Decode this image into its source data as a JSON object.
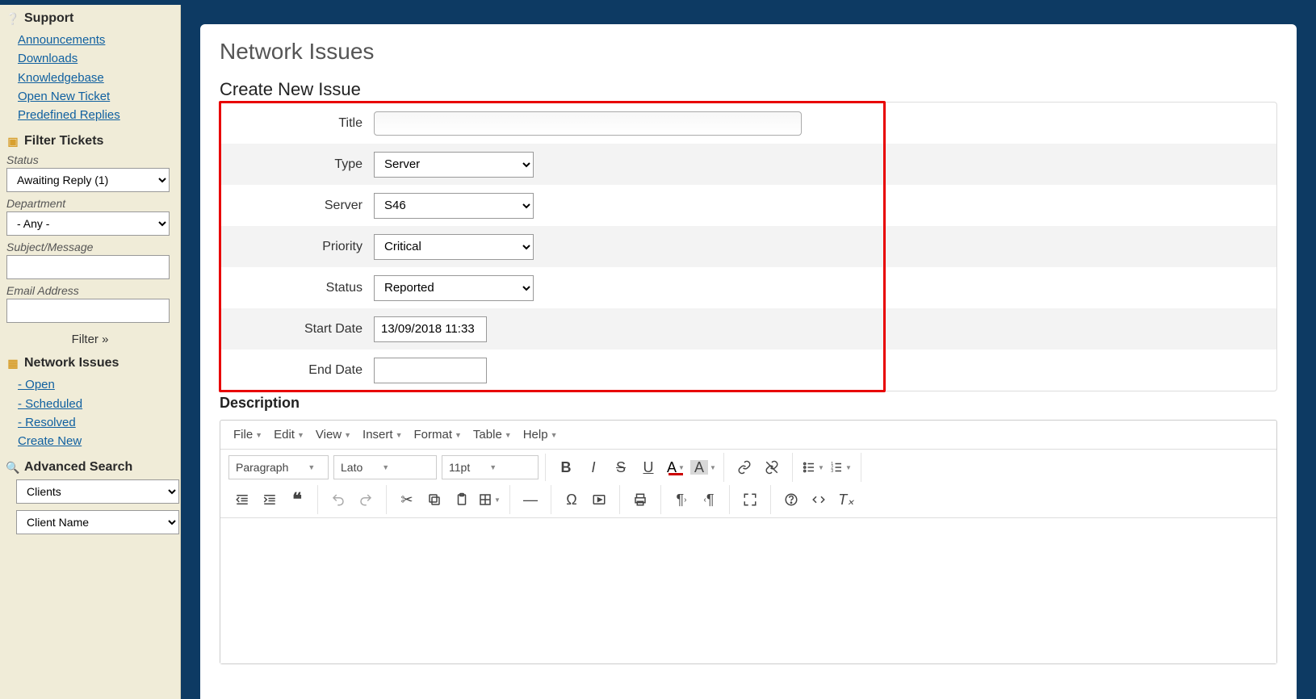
{
  "sidebar": {
    "support_header": "Support",
    "support_links": [
      "Announcements",
      "Downloads",
      "Knowledgebase",
      "Open New Ticket",
      "Predefined Replies"
    ],
    "filter_header": "Filter Tickets",
    "status_label": "Status",
    "status_value": "Awaiting Reply (1)",
    "department_label": "Department",
    "department_value": "- Any -",
    "subject_label": "Subject/Message",
    "subject_value": "",
    "email_label": "Email Address",
    "email_value": "",
    "filter_button": "Filter »",
    "network_header": "Network Issues",
    "network_links": [
      "- Open",
      "- Scheduled",
      "- Resolved",
      "Create New"
    ],
    "search_header": "Advanced Search",
    "search_sel1": "Clients",
    "search_sel2": "Client Name"
  },
  "main": {
    "title": "Network Issues",
    "subtitle": "Create New Issue",
    "form": {
      "title_label": "Title",
      "title_value": "",
      "type_label": "Type",
      "type_value": "Server",
      "server_label": "Server",
      "server_value": "S46",
      "priority_label": "Priority",
      "priority_value": "Critical",
      "status_label": "Status",
      "status_value": "Reported",
      "start_label": "Start Date",
      "start_value": "13/09/2018 11:33",
      "end_label": "End Date",
      "end_value": ""
    },
    "desc_label": "Description"
  },
  "editor": {
    "menus": [
      "File",
      "Edit",
      "View",
      "Insert",
      "Format",
      "Table",
      "Help"
    ],
    "para": "Paragraph",
    "font": "Lato",
    "size": "11pt"
  }
}
